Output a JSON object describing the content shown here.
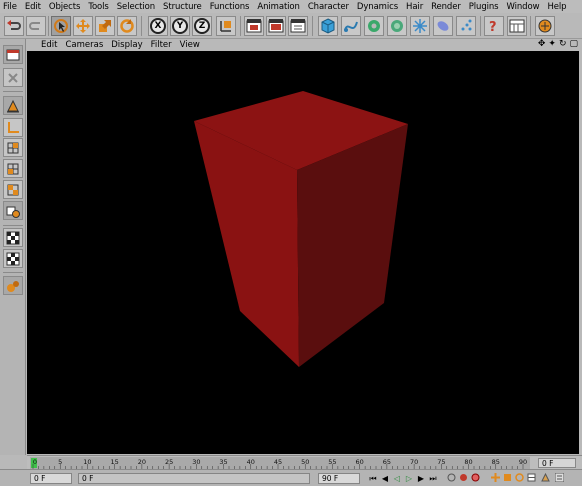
{
  "menu": [
    "File",
    "Edit",
    "Objects",
    "Tools",
    "Selection",
    "Structure",
    "Functions",
    "Animation",
    "Character",
    "Dynamics",
    "Hair",
    "Render",
    "Plugins",
    "Window",
    "Help"
  ],
  "toolbar": {
    "axis_x": "X",
    "axis_y": "Y",
    "axis_z": "Z",
    "icons": [
      "undo-icon",
      "redo-icon",
      "live-selection-icon",
      "move-icon",
      "scale-icon",
      "rotate-icon",
      "x-axis-lock-icon",
      "y-axis-lock-icon",
      "z-axis-lock-icon",
      "coordinate-system-icon",
      "render-view-icon",
      "render-picture-viewer-icon",
      "render-settings-icon",
      "cube-primitive-icon",
      "spline-icon",
      "nurbs-icon",
      "array-icon",
      "particle-icon",
      "deformer-icon",
      "scene-icon",
      "camera-icon",
      "light-icon",
      "help-icon",
      "layout-icon",
      "palette-icon"
    ]
  },
  "viewport": {
    "menu": [
      "Edit",
      "Cameras",
      "Display",
      "Filter",
      "View"
    ],
    "nav_icons": [
      "✥",
      "✦",
      "↻",
      "▢"
    ],
    "background": "#000000",
    "object_color_front": "#8a1212",
    "object_color_side": "#5a0e0e",
    "object_color_top": "#8c1313"
  },
  "timeline": {
    "ticks": [
      "0",
      "5",
      "10",
      "15",
      "20",
      "25",
      "30",
      "35",
      "40",
      "45",
      "50",
      "55",
      "60",
      "65",
      "70",
      "75",
      "80",
      "85",
      "90"
    ],
    "current_frame": "0 F"
  },
  "bottombar": {
    "start_frame": "0 F",
    "mid_frame": "0 F",
    "end_frame": "90 F",
    "playback_buttons": [
      "⏮",
      "◀",
      "◁",
      "▷",
      "▶",
      "⏭"
    ]
  }
}
